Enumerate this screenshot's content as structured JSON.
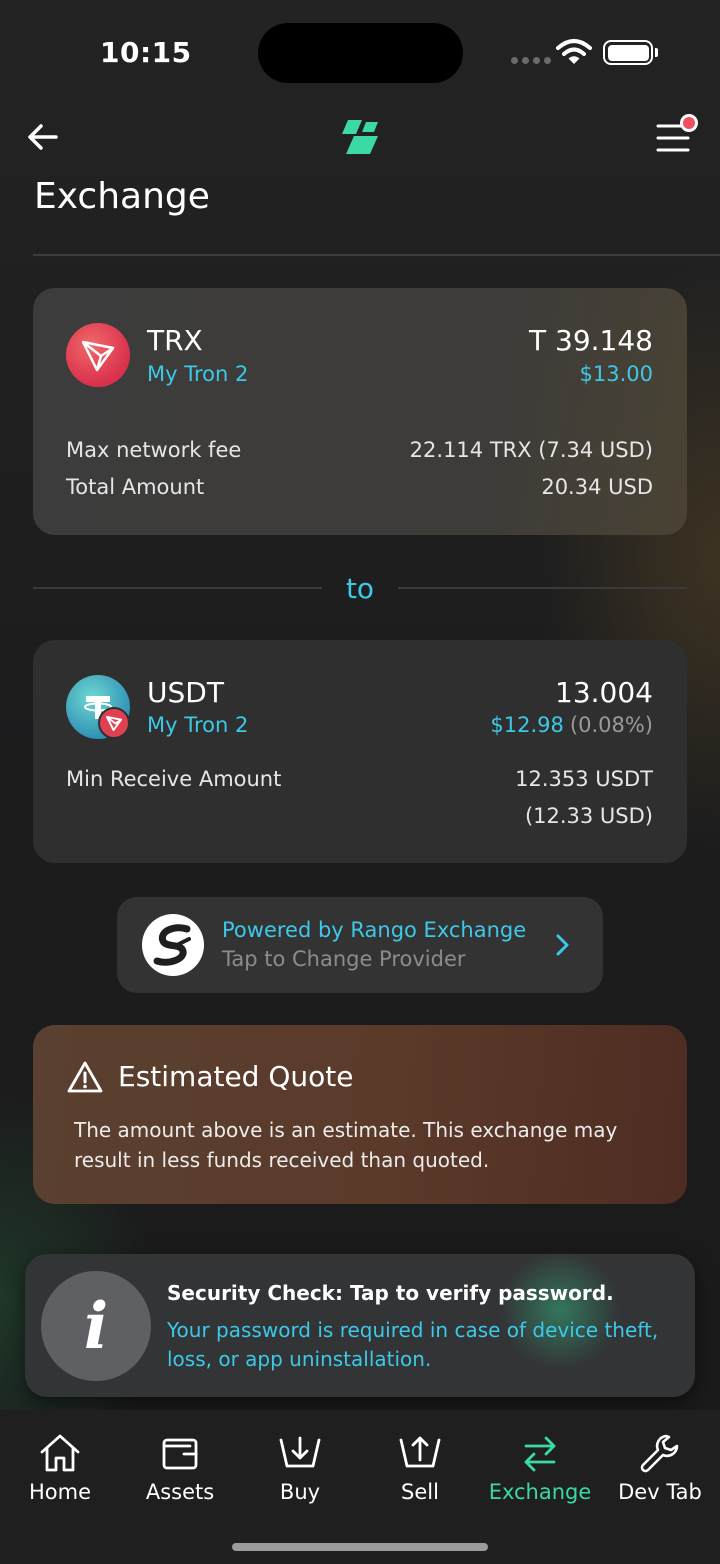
{
  "status_bar": {
    "time": "10:15"
  },
  "header": {
    "title": "Exchange"
  },
  "from": {
    "symbol": "TRX",
    "wallet": "My Tron 2",
    "amount": "T 39.148",
    "usd": "$13.00",
    "fee_label": "Max network fee",
    "fee_value": "22.114 TRX (7.34 USD)",
    "total_label": "Total Amount",
    "total_value": "20.34 USD"
  },
  "divider_label": "to",
  "to": {
    "symbol": "USDT",
    "wallet": "My Tron 2",
    "amount": "13.004",
    "usd": "$12.98",
    "usd_diff": "(0.08%)",
    "min_label": "Min Receive Amount",
    "min_value_line1": "12.353 USDT",
    "min_value_line2": "(12.33 USD)"
  },
  "provider": {
    "title": "Powered by Rango Exchange",
    "subtitle": "Tap to Change Provider"
  },
  "warning": {
    "title": "Estimated Quote",
    "body": "The amount above is an estimate. This exchange may result in less funds received than quoted."
  },
  "toast": {
    "title": "Security Check: Tap to verify password.",
    "body": "Your password is required in case of device theft, loss, or app uninstallation."
  },
  "nav": {
    "items": [
      {
        "label": "Home",
        "icon": "home-icon"
      },
      {
        "label": "Assets",
        "icon": "wallet-icon"
      },
      {
        "label": "Buy",
        "icon": "buy-icon"
      },
      {
        "label": "Sell",
        "icon": "sell-icon"
      },
      {
        "label": "Exchange",
        "icon": "exchange-icon"
      },
      {
        "label": "Dev Tab",
        "icon": "wrench-icon"
      }
    ],
    "active_color": "#3ad9a6"
  },
  "colors": {
    "accent": "#3cc9e8",
    "brand_green": "#3ad9a6",
    "badge_red": "#f04e5e"
  }
}
